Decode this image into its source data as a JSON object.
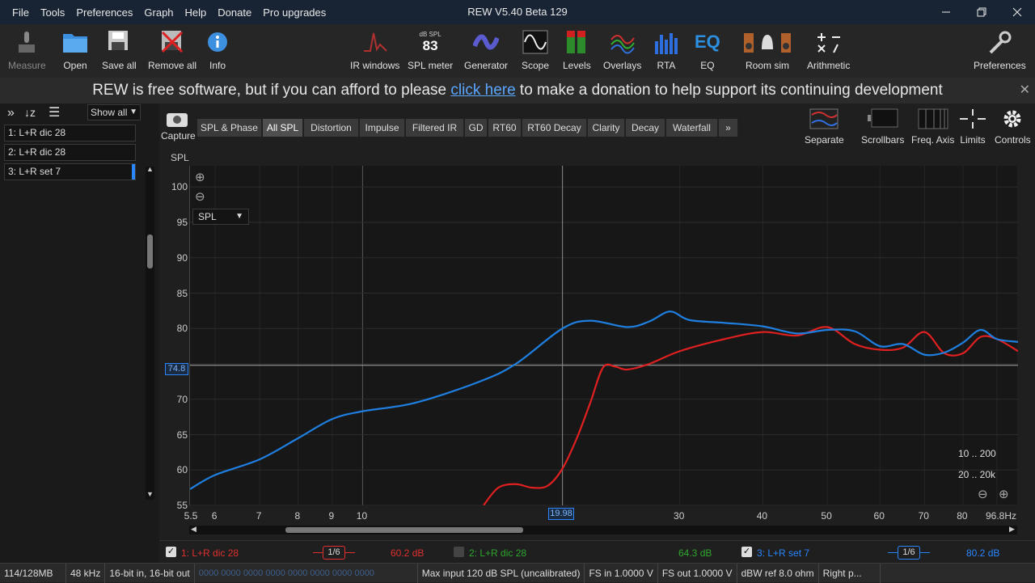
{
  "menu": [
    "File",
    "Tools",
    "Preferences",
    "Graph",
    "Help",
    "Donate",
    "Pro upgrades"
  ],
  "window_title": "REW V5.40 Beta 129",
  "toolbar": {
    "measure": "Measure",
    "open": "Open",
    "save_all": "Save all",
    "remove_all": "Remove all",
    "info": "Info",
    "ir_windows": "IR windows",
    "spl_meter": "SPL meter",
    "spl_unit": "dB SPL",
    "spl_value": "83",
    "generator": "Generator",
    "scope": "Scope",
    "levels": "Levels",
    "overlays": "Overlays",
    "rta": "RTA",
    "eq": "EQ",
    "eq_icon_text": "EQ",
    "room_sim": "Room sim",
    "arithmetic": "Arithmetic",
    "preferences": "Preferences"
  },
  "banner": {
    "before": "REW is free software, but if you can afford to please ",
    "link": "click here",
    "after": " to make a donation to help support its continuing development"
  },
  "left": {
    "show_all": "Show all",
    "measurements": [
      "1: L+R dic 28",
      "2: L+R dic 28",
      "3: L+R set 7"
    ]
  },
  "graph": {
    "capture": "Capture",
    "tabs": [
      "SPL & Phase",
      "All SPL",
      "Distortion",
      "Impulse",
      "Filtered IR",
      "GD",
      "RT60",
      "RT60 Decay",
      "Clarity",
      "Decay",
      "Waterfall",
      "»"
    ],
    "selected_tab": "All SPL",
    "right_tools": {
      "separate": "Separate",
      "scrollbars": "Scrollbars",
      "freq_axis": "Freq. Axis",
      "limits": "Limits",
      "controls": "Controls"
    },
    "y_axis_label": "SPL",
    "spl_select": "SPL",
    "cursor_y": "74.8",
    "cursor_x": "19.98",
    "range1": "10 .. 200",
    "range2": "20 .. 20k"
  },
  "chart_data": {
    "type": "line",
    "x_scale": "log",
    "xlim": [
      5.5,
      96.8
    ],
    "ylim": [
      55,
      103
    ],
    "y_ticks": [
      55,
      60,
      65,
      70,
      75,
      80,
      85,
      90,
      95,
      100
    ],
    "y_tick_labels": [
      "55",
      "60",
      "65",
      "70",
      "",
      "80",
      "85",
      "90",
      "95",
      "100"
    ],
    "x_tick_labels": [
      "5.5",
      "6",
      "7",
      "8",
      "9",
      "10",
      "30",
      "40",
      "50",
      "60",
      "70",
      "80",
      "96.8Hz"
    ],
    "x_tick_values": [
      5.5,
      6,
      7,
      8,
      9,
      10,
      30,
      40,
      50,
      60,
      70,
      80,
      96.8
    ],
    "cursor": {
      "x": 19.98,
      "y": 74.8
    },
    "series": [
      {
        "color": "#1f7fe0",
        "x": [
          5.5,
          6,
          7,
          8,
          9,
          10,
          12,
          15,
          17,
          19.98,
          22,
          25,
          27,
          29,
          31,
          35,
          40,
          45,
          50,
          55,
          60,
          65,
          70,
          75,
          80,
          85,
          90,
          96.8
        ],
        "y": [
          57.3,
          59.3,
          61.5,
          64.5,
          67.2,
          68.3,
          69.5,
          72.5,
          75,
          80,
          81.1,
          80.2,
          81,
          82.4,
          81.2,
          80.8,
          80.3,
          79.3,
          79.8,
          79.6,
          77.5,
          77.8,
          76.3,
          76.6,
          78,
          79.8,
          78.5,
          78.1
        ]
      },
      {
        "color": "#e02020",
        "x": [
          15.2,
          16,
          17,
          18,
          19,
          19.98,
          21,
          22,
          23,
          24,
          25,
          27,
          30,
          35,
          40,
          45,
          50,
          55,
          60,
          65,
          70,
          75,
          80,
          85,
          90,
          96.8
        ],
        "y": [
          55,
          57.5,
          58,
          57.5,
          57.8,
          60.2,
          64.5,
          69.5,
          74.5,
          74.6,
          74.2,
          75,
          76.8,
          78.5,
          79.5,
          79,
          80.2,
          77.8,
          77,
          77.3,
          79.5,
          76.5,
          76.5,
          78.8,
          78.5,
          76.8
        ]
      }
    ]
  },
  "legend": [
    {
      "name": "1: L+R dic 28",
      "smooth": "1/6",
      "value": "60.2 dB",
      "color": "#e03030",
      "checked": true
    },
    {
      "name": "2: L+R dic 28",
      "smooth": "",
      "value": "64.3 dB",
      "color": "#2fa62f",
      "checked": false
    },
    {
      "name": "3: L+R set 7",
      "smooth": "1/6",
      "value": "80.2 dB",
      "color": "#2a86ff",
      "checked": true
    }
  ],
  "status": [
    "114/128MB",
    "48 kHz",
    "16-bit in, 16-bit out",
    "0000 0000  0000 0000  0000 0000  0000 0000",
    "Max input 120 dB SPL (uncalibrated)",
    "FS in 1.0000 V",
    "FS out 1.0000 V",
    "dBW ref 8.0 ohm",
    "Right p..."
  ]
}
